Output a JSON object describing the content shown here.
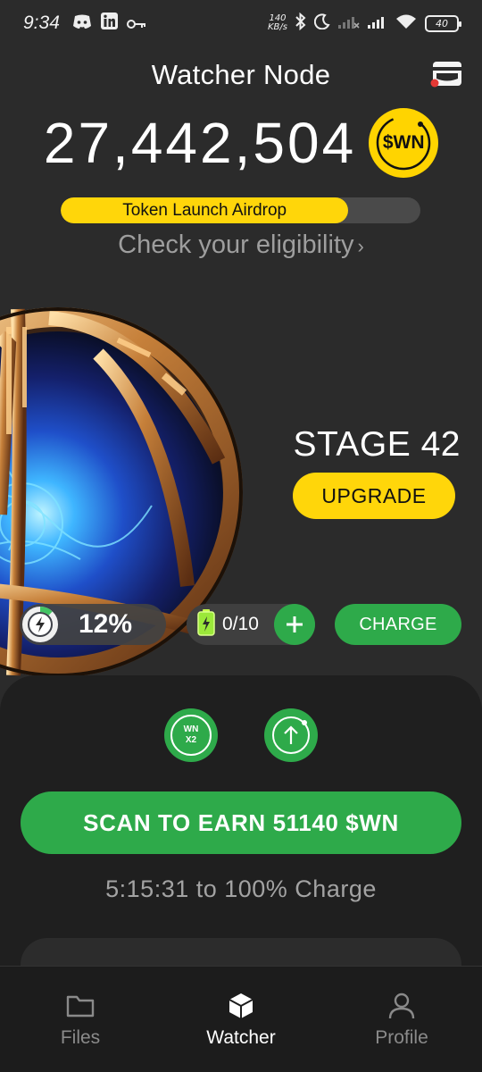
{
  "status_bar": {
    "time": "9:34",
    "network_speed_value": "140",
    "network_speed_unit": "KB/s",
    "battery_level": "40"
  },
  "header": {
    "title": "Watcher Node"
  },
  "balance": {
    "amount": "27,442,504",
    "token_symbol": "$WN"
  },
  "airdrop": {
    "label": "Token Launch Airdrop",
    "progress_fraction": 0.8,
    "eligibility_text": "Check your eligibility",
    "eligibility_chevron": "›"
  },
  "stage": {
    "label": "STAGE 42",
    "upgrade_label": "UPGRADE"
  },
  "energy": {
    "percent_text": "12%",
    "percent_value": 12
  },
  "batteries": {
    "count_text": "0/10"
  },
  "charge": {
    "label": "CHARGE"
  },
  "boost": {
    "line1": "WN",
    "line2": "X2"
  },
  "scan": {
    "label": "SCAN TO EARN 51140 $WN"
  },
  "timer": {
    "text": "5:15:31 to 100% Charge"
  },
  "nav": {
    "items": [
      {
        "label": "Files",
        "icon": "folder-icon",
        "active": false
      },
      {
        "label": "Watcher",
        "icon": "cube-icon",
        "active": true
      },
      {
        "label": "Profile",
        "icon": "person-icon",
        "active": false
      }
    ]
  },
  "colors": {
    "background": "#2b2b2b",
    "accent_yellow": "#ffd60a",
    "accent_green": "#2eaa4a",
    "muted_text": "#9e9e9e"
  }
}
